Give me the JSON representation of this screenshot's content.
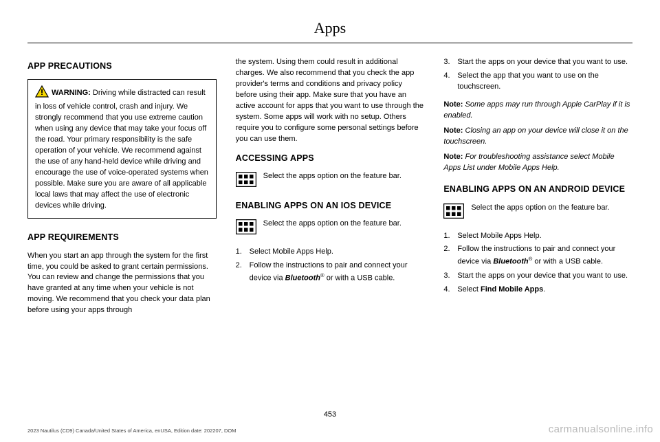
{
  "header": {
    "title": "Apps"
  },
  "col1": {
    "h_precautions": "APP PRECAUTIONS",
    "warning_label": "WARNING:",
    "warning_text": " Driving while distracted can result in loss of vehicle control, crash and injury. We strongly recommend that you use extreme caution when using any device that may take your focus off the road. Your primary responsibility is the safe operation of your vehicle. We recommend against the use of any hand-held device while driving and encourage the use of voice-operated systems when possible. Make sure you are aware of all applicable local laws that may affect the use of electronic devices while driving.",
    "h_requirements": "APP REQUIREMENTS",
    "requirements_p": "When you start an app through the system for the first time, you could be asked to grant certain permissions. You can review and change the permissions that you have granted at any time when your vehicle is not moving. We recommend that you check your data plan before using your apps through"
  },
  "col2": {
    "continuation": "the system. Using them could result in additional charges. We also recommend that you check the app provider's terms and conditions and privacy policy before using their app. Make sure that you have an active account for apps that you want to use through the system. Some apps will work with no setup. Others require you to configure some personal settings before you can use them.",
    "h_accessing": "ACCESSING APPS",
    "access_text": "Select the apps option on the feature bar.",
    "h_ios": "ENABLING APPS ON AN IOS DEVICE",
    "ios_icon_text": "Select the apps option on the feature bar.",
    "ios_steps": [
      {
        "n": "1.",
        "t": "Select Mobile Apps Help."
      },
      {
        "n": "2.",
        "t_pre": "Follow the instructions to pair and connect your device via ",
        "t_bold": "Bluetooth",
        "t_post": " or with a USB cable."
      }
    ]
  },
  "col3": {
    "steps_cont": [
      {
        "n": "3.",
        "t": "Start the apps on your device that you want to use."
      },
      {
        "n": "4.",
        "t": "Select the app that you want to use on the touchscreen."
      }
    ],
    "note1_label": "Note:",
    "note1_text": " Some apps may run through Apple CarPlay if it is enabled.",
    "note2_label": "Note:",
    "note2_text": " Closing an app on your device will close it on the touchscreen.",
    "note3_label": "Note:",
    "note3_text": " For troubleshooting assistance select Mobile Apps List under Mobile Apps Help.",
    "h_android": "ENABLING APPS ON AN ANDROID DEVICE",
    "android_icon_text": "Select the apps option on the feature bar.",
    "android_steps": [
      {
        "n": "1.",
        "t": "Select Mobile Apps Help."
      },
      {
        "n": "2.",
        "t_pre": "Follow the instructions to pair and connect your device via ",
        "t_bold": "Bluetooth",
        "t_post": " or with a USB cable."
      },
      {
        "n": "3.",
        "t": "Start the apps on your device that you want to use."
      },
      {
        "n": "4.",
        "t_pre": "Select ",
        "t_bold": "Find Mobile Apps",
        "t_post": "."
      }
    ]
  },
  "page_number": "453",
  "footer_left": "2023 Nautilus (CD9) Canada/United States of America, enUSA, Edition date: 202207, DOM",
  "footer_right": "carmanualsonline.info"
}
